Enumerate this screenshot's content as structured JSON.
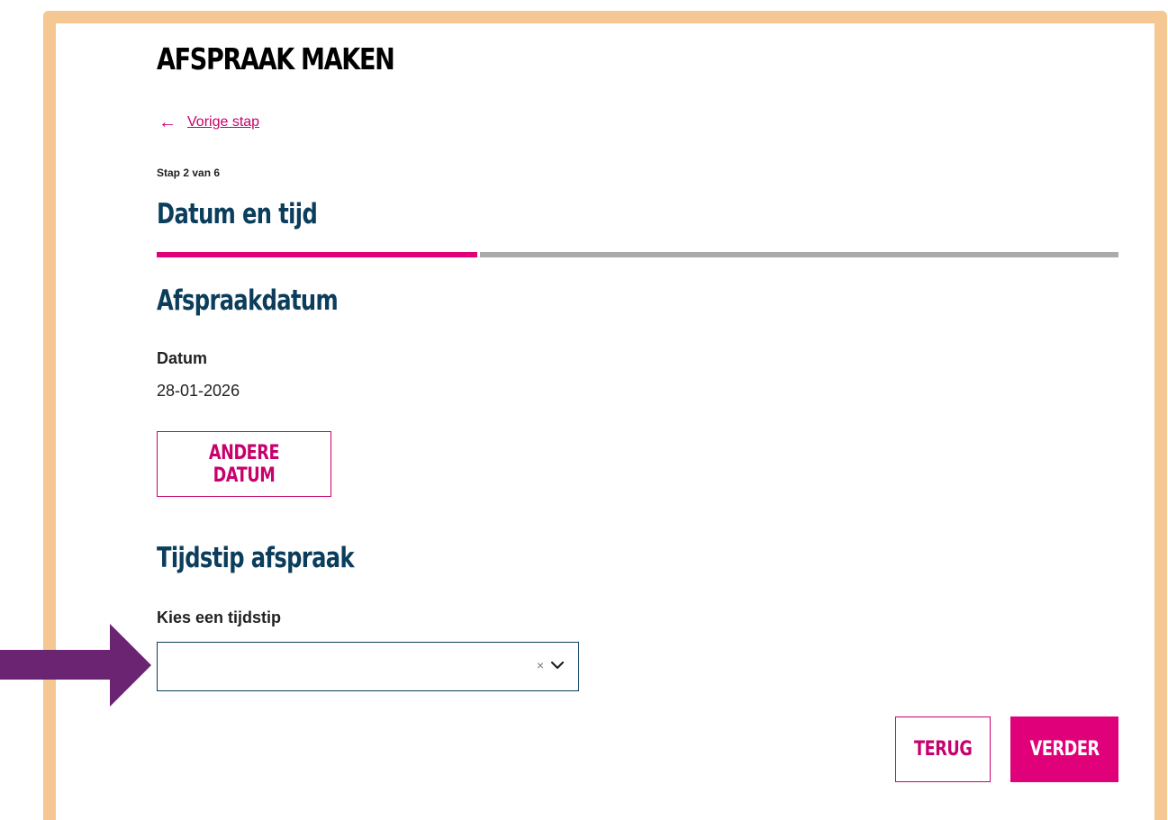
{
  "page": {
    "title": "AFSPRAAK MAKEN",
    "back_link": "Vorige stap",
    "step_counter": "Stap 2 van 6",
    "step_title": "Datum en tijd",
    "progress_fraction": 0.333
  },
  "date_section": {
    "heading": "Afspraakdatum",
    "label": "Datum",
    "value": "28-01-2026",
    "change_button": "ANDERE DATUM"
  },
  "time_section": {
    "heading": "Tijdstip afspraak",
    "label": "Kies een tijdstip",
    "selected": "",
    "clear_glyph": "×"
  },
  "actions": {
    "back_button": "TERUG",
    "next_button": "VERDER"
  },
  "colors": {
    "accent": "#e0007a",
    "heading": "#0b3d5c",
    "frame": "#f5c792",
    "annotation_arrow": "#6b2472"
  },
  "icons": {
    "back": "arrow-left-icon",
    "dropdown": "chevron-down-icon",
    "clear": "close-icon",
    "annotation": "annotation-arrow-icon"
  }
}
